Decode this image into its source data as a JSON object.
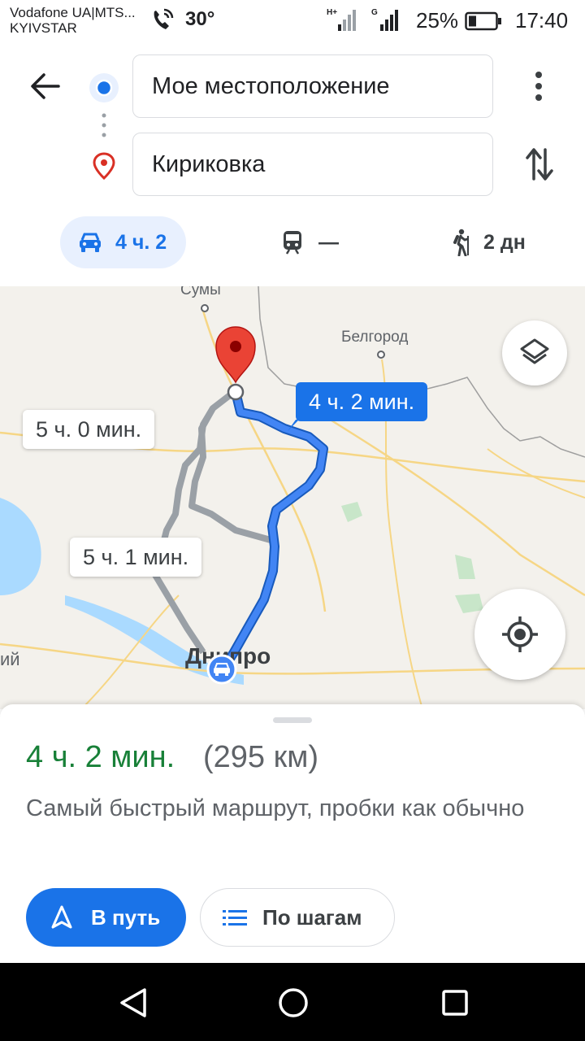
{
  "status_bar": {
    "carrier_line1": "Vodafone UA|MTS...",
    "carrier_line2": "KYIVSTAR",
    "temperature": "30°",
    "battery": "25%",
    "time": "17:40"
  },
  "header": {
    "origin": "Мое местоположение",
    "destination": "Кириковка",
    "modes": [
      {
        "name": "car",
        "label": "4 ч. 2",
        "selected": true
      },
      {
        "name": "transit",
        "label": "—",
        "selected": false
      },
      {
        "name": "walk",
        "label": "2 дн",
        "selected": false
      }
    ]
  },
  "map": {
    "cities": {
      "sumy": "Сумы",
      "belgorod": "Белгород",
      "dnipro": "Днипро",
      "partial_left": "ий"
    },
    "routes": {
      "main": "4 ч. 2 мин.",
      "alt1": "5 ч. 0 мин.",
      "alt2": "5 ч. 1 мин."
    }
  },
  "sheet": {
    "duration": "4 ч. 2 мин.",
    "distance": "(295 км)",
    "summary": "Самый быстрый маршрут, пробки как обычно",
    "go_label": "В путь",
    "steps_label": "По шагам"
  },
  "colors": {
    "accent": "#1a73e8",
    "duration_green": "#188038",
    "pin_red": "#ea4335"
  }
}
